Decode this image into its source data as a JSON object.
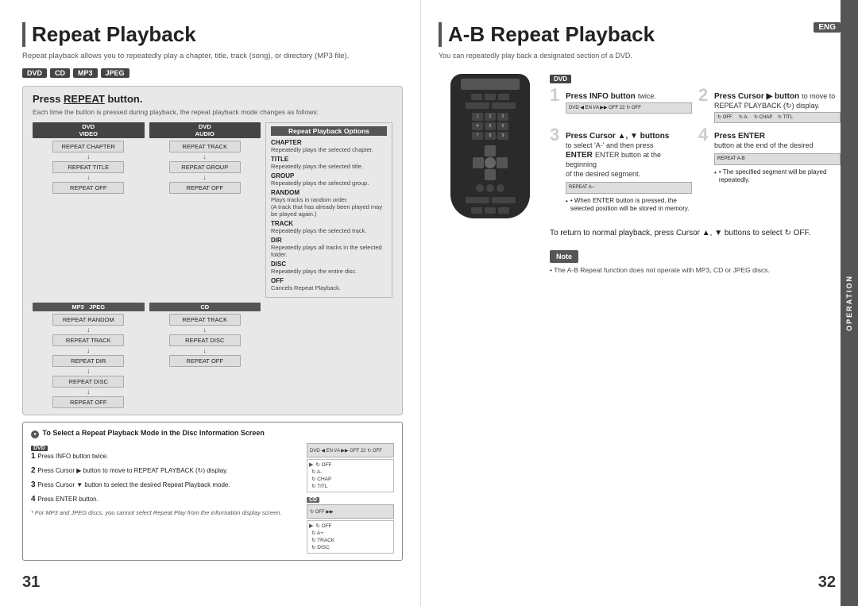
{
  "left_page": {
    "page_number": "31",
    "title": "Repeat Playback",
    "subtitle": "Repeat playback allows you to repeatedly play a chapter, title, track (song), or directory (MP3 file).",
    "formats": [
      "DVD",
      "CD",
      "MP3",
      "JPEG"
    ],
    "press_repeat_title": "Press REPEAT button.",
    "press_repeat_sub": "Each time the button is pressed during playback, the repeat playback mode changes as follows:",
    "dvd_video_label": "DVD VIDEO",
    "dvd_audio_label": "DVD AUDIO",
    "mp3_label": "MP3",
    "jpeg_label": "JPEG",
    "cd_label": "CD",
    "repeat_options_title": "Repeat Playback Options",
    "options": [
      {
        "name": "CHAPTER",
        "desc": "Repeatedly plays the selected chapter."
      },
      {
        "name": "TITLE",
        "desc": "Repeatedly plays the selected title."
      },
      {
        "name": "GROUP",
        "desc": "Repeatedly plays the selected group."
      },
      {
        "name": "RANDOM",
        "desc": "Plays tracks in random order. (A track that has already been played may be played again.)"
      },
      {
        "name": "TRACK",
        "desc": "Repeatedly plays the selected track."
      },
      {
        "name": "DIR",
        "desc": "Repeatedly plays all tracks in the selected folder."
      },
      {
        "name": "DISC",
        "desc": "Repeatedly plays the entire disc."
      },
      {
        "name": "OFF",
        "desc": "Cancels Repeat Playback."
      }
    ],
    "select_mode_title": "To Select a Repeat Playback Mode in the Disc Information Screen",
    "steps": [
      {
        "num": "1",
        "text": "Press INFO button twice."
      },
      {
        "num": "2",
        "text": "Press Cursor ▶ button to move to REPEAT PLAYBACK (↻) display."
      },
      {
        "num": "3",
        "text": "Press Cursor ▼ button to select the desired Repeat Playback mode."
      },
      {
        "num": "4",
        "text": "Press ENTER button."
      }
    ],
    "footer_note": "* For MP3 and JPEG discs, you cannot select Repeat Play from the information display screen.",
    "dvd_flow": [
      "REPEAT CHAPTER",
      "REPEAT TITLE",
      "REPEAT OFF"
    ],
    "dvd_audio_flow": [
      "REPEAT TRACK",
      "REPEAT GROUP",
      "REPEAT OFF"
    ],
    "mp3_flow": [
      "REPEAT RANDOM",
      "REPEAT TRACK",
      "REPEAT DIR",
      "REPEAT DISC",
      "REPEAT OFF"
    ],
    "cd_flow": [
      "REPEAT TRACK",
      "REPEAT DISC",
      "REPEAT OFF"
    ],
    "disc_entries_dvd": [
      "↻ OFF",
      "↻ A-",
      "↻ CHAP",
      "↻ TITL"
    ],
    "disc_entries_cd": [
      "↻ OFF",
      "↻ A+",
      "↻ TRACK",
      "↻ DISC"
    ]
  },
  "right_page": {
    "page_number": "32",
    "title": "A-B Repeat Playback",
    "eng_badge": "ENG",
    "subtitle": "You can repeatedly play back a designated section of a DVD.",
    "dvd_format": "DVD",
    "step1_bold": "Press INFO button",
    "step1_normal": "twice.",
    "step2_bold": "Press Cursor ▶ button",
    "step2_normal": "to move to REPEAT PLAYBACK (↻) display.",
    "step3_bold": "Press Cursor ▲, ▼ buttons",
    "step3_normal1": "to select 'A-' and then press",
    "step3_normal2": "ENTER button at the beginning",
    "step3_normal3": "of the desired segment.",
    "step4_bold": "Press ENTER",
    "step4_normal": "button at the end of the desired",
    "step3_note": "• When ENTER button is pressed, the selected position will be stored in memory.",
    "step4_note": "• The specified segment will be played repeatedly.",
    "operation_label": "OPERATION",
    "return_text": "To return to normal playback, press Cursor ▲, ▼ buttons to select ↻ OFF.",
    "note_label": "Note",
    "note_text": "• The A-B Repeat function does not operate with MP3, CD or JPEG discs.",
    "screen_repeat_am": "REPEAT A--",
    "screen_repeat_ab": "REPEAT A-B"
  }
}
